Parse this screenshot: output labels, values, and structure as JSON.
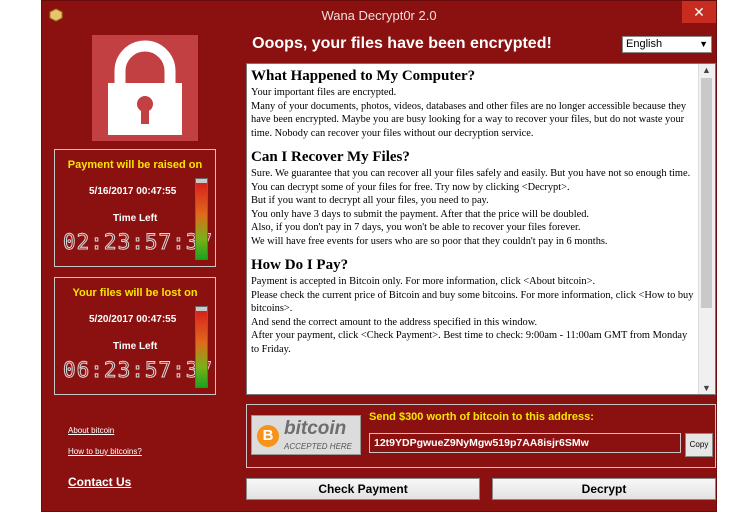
{
  "window": {
    "title": "Wana Decrypt0r 2.0",
    "close_glyph": "✕"
  },
  "headline": "Ooops, your files have been encrypted!",
  "language": {
    "selected": "English"
  },
  "timers": [
    {
      "heading": "Payment will be raised on",
      "date": "5/16/2017 00:47:55",
      "time_left_label": "Time Left",
      "countdown": "02:23:57:37",
      "level": 0.95
    },
    {
      "heading": "Your files will be lost on",
      "date": "5/20/2017 00:47:55",
      "time_left_label": "Time Left",
      "countdown": "06:23:57:37",
      "level": 0.95
    }
  ],
  "links": {
    "about_bitcoin": "About bitcoin",
    "how_to_buy": "How to buy bitcoins?",
    "contact": "Contact Us"
  },
  "content": {
    "s1_title": "What Happened to My Computer?",
    "s1_p1": "Your important files are encrypted.",
    "s1_p2": "Many of your documents, photos, videos, databases and other files are no longer accessible because they have been encrypted. Maybe you are busy looking for a way to recover your files, but do not waste your time. Nobody can recover your files without our decryption service.",
    "s2_title": "Can I Recover My Files?",
    "s2_p1": "Sure. We guarantee that you can recover all your files safely and easily. But you have not so enough time.",
    "s2_p2": "You can decrypt some of your files for free. Try now by clicking <Decrypt>.",
    "s2_p3": "But if you want to decrypt all your files, you need to pay.",
    "s2_p4": "You only have 3 days to submit the payment. After that the price will be doubled.",
    "s2_p5": "Also, if you don't pay in 7 days, you won't be able to recover your files forever.",
    "s2_p6": "We will have free events for users who are so poor that they couldn't pay in 6 months.",
    "s3_title": "How Do I Pay?",
    "s3_p1": "Payment is accepted in Bitcoin only. For more information, click <About bitcoin>.",
    "s3_p2": "Please check the current price of Bitcoin and buy some bitcoins. For more information, click <How to buy bitcoins>.",
    "s3_p3": "And send the correct amount to the address specified in this window.",
    "s3_p4": "After your payment, click <Check Payment>. Best time to check: 9:00am - 11:00am GMT from Monday to Friday."
  },
  "bitcoin": {
    "logo_word": "bitcoin",
    "logo_sub": "ACCEPTED HERE",
    "logo_symbol": "B"
  },
  "payment": {
    "send_label": "Send $300 worth of bitcoin to this address:",
    "address": "12t9YDPgwueZ9NyMgw519p7AA8isjr6SMw",
    "copy_label": "Copy"
  },
  "buttons": {
    "check_payment": "Check Payment",
    "decrypt": "Decrypt"
  },
  "colors": {
    "background": "#8b1111",
    "accent_yellow": "#f7e600",
    "lock_panel": "#c24041"
  }
}
